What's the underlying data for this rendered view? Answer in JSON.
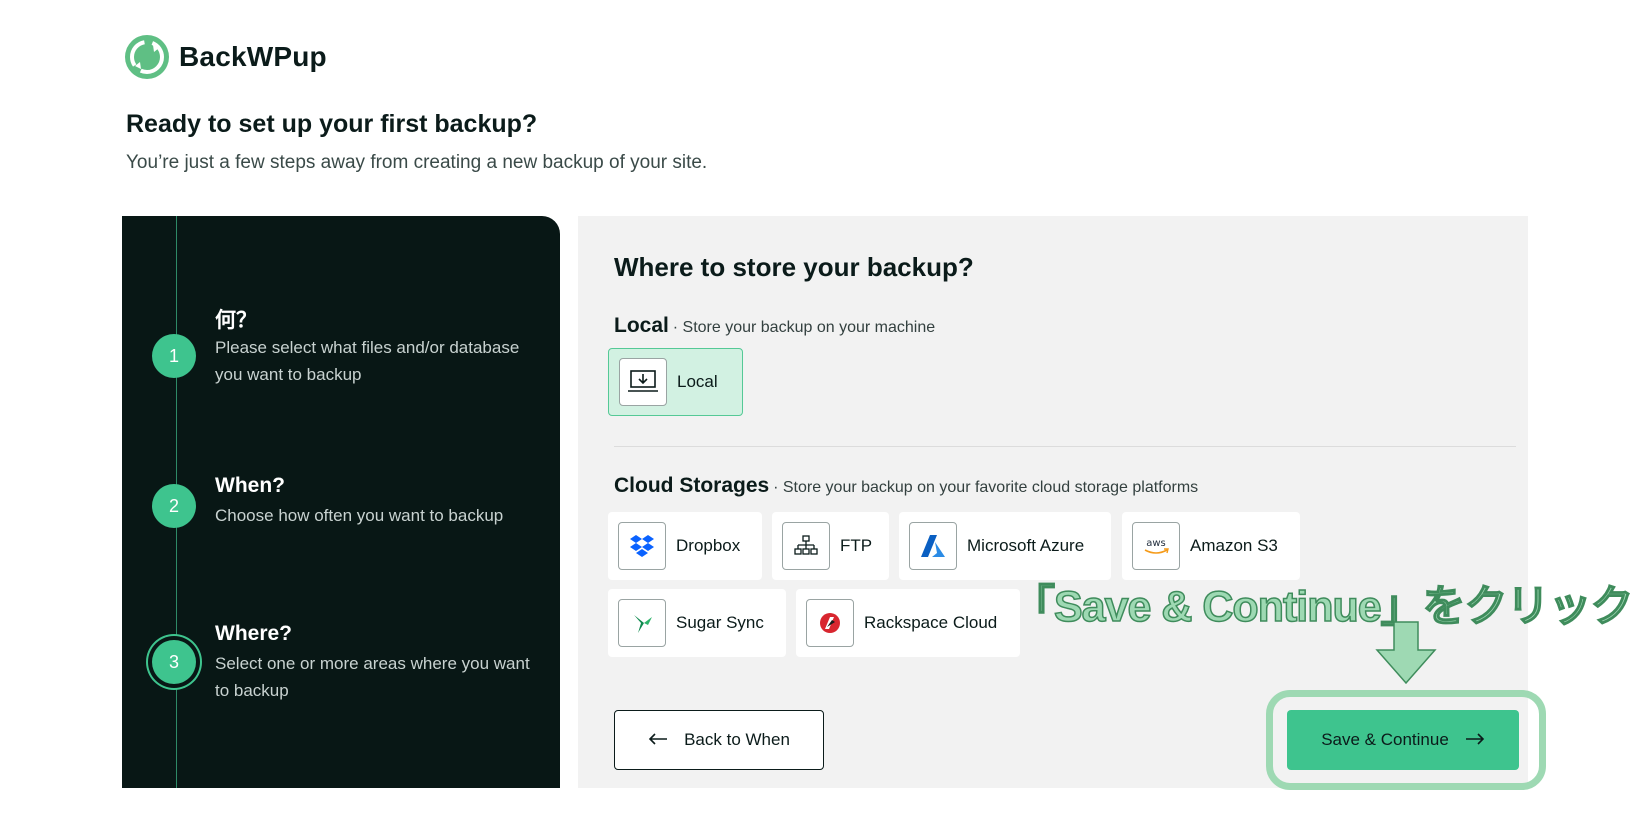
{
  "brand": {
    "name": "BackWPup"
  },
  "intro": {
    "title": "Ready to set up your first backup?",
    "subtitle": "You’re just a few steps away from creating a new backup of your site."
  },
  "steps": [
    {
      "number": "1",
      "title": "何？",
      "description": "Please select what files and/or database you want to backup",
      "state": "done"
    },
    {
      "number": "2",
      "title": "When?",
      "description": "Choose how often you want to backup",
      "state": "done"
    },
    {
      "number": "3",
      "title": "Where?",
      "description": "Select one or more areas where you want to backup",
      "state": "active"
    }
  ],
  "main": {
    "title": "Where to store your backup?",
    "local": {
      "label": "Local",
      "description": "· Store your backup on your machine",
      "options": [
        {
          "label": "Local",
          "icon": "laptop-download-icon",
          "selected": true
        }
      ]
    },
    "cloud": {
      "label": "Cloud Storages",
      "description": "· Store your backup on your favorite cloud storage platforms",
      "options": [
        {
          "label": "Dropbox",
          "icon": "dropbox-icon",
          "selected": false
        },
        {
          "label": "FTP",
          "icon": "ftp-network-icon",
          "selected": false
        },
        {
          "label": "Microsoft Azure",
          "icon": "azure-icon",
          "selected": false
        },
        {
          "label": "Amazon S3",
          "icon": "aws-icon",
          "selected": false
        },
        {
          "label": "Sugar Sync",
          "icon": "sugarsync-icon",
          "selected": false
        },
        {
          "label": "Rackspace Cloud",
          "icon": "rackspace-icon",
          "selected": false
        }
      ]
    },
    "back_label": "Back to When",
    "save_label": "Save & Continue"
  },
  "annotation": {
    "text": "「Save & Continue」をクリック"
  },
  "colors": {
    "accent": "#3ec48e",
    "panel_dark": "#081715",
    "selected_bg": "#d2f1e2",
    "annotation": "#9ed9b3"
  }
}
